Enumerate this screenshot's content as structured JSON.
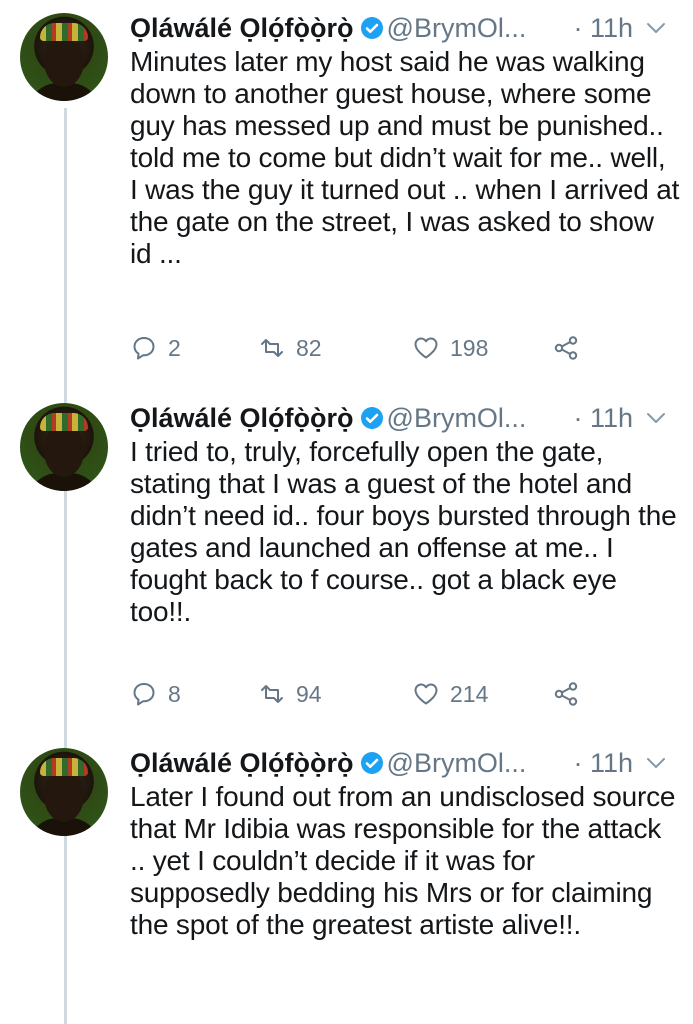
{
  "tweets": [
    {
      "name": "Ọláwálé Ọlọ́fọ̀ọ̀rọ̀",
      "handle": "@BrymOl...",
      "time": "· 11h",
      "text": "Minutes later my host said he was walking down to another guest house, where some guy has messed up and must be punished.. told me to come but didn’t wait for me.. well, I was the guy it turned out .. when I arrived at the gate on the street, I was asked to show id ...",
      "replies": "2",
      "retweets": "82",
      "likes": "198"
    },
    {
      "name": "Ọláwálé Ọlọ́fọ̀ọ̀rọ̀",
      "handle": "@BrymOl...",
      "time": "· 11h",
      "text": "I tried to, truly, forcefully open the gate, stating that I was a guest of the hotel and didn’t need id.. four boys bursted through the gates and launched an offense at me.. I fought back to f course.. got a black eye too!!.",
      "replies": "8",
      "retweets": "94",
      "likes": "214"
    },
    {
      "name": "Ọláwálé Ọlọ́fọ̀ọ̀rọ̀",
      "handle": "@BrymOl...",
      "time": "· 11h",
      "text": "Later I found out from an undisclosed source that Mr Idibia was responsible for the attack .. yet I couldn’t decide if it was for supposedly bedding his Mrs or for claiming the spot of the greatest artiste alive!!.",
      "replies": "",
      "retweets": "",
      "likes": ""
    }
  ],
  "icons": {
    "verified": "verified-badge-icon",
    "caret": "chevron-down-icon",
    "reply": "reply-icon",
    "retweet": "retweet-icon",
    "like": "heart-icon",
    "share": "share-icon"
  },
  "colors": {
    "verified": "#1da1f2",
    "text": "#14171a",
    "muted": "#657786",
    "thread_line": "#cfd9de"
  }
}
